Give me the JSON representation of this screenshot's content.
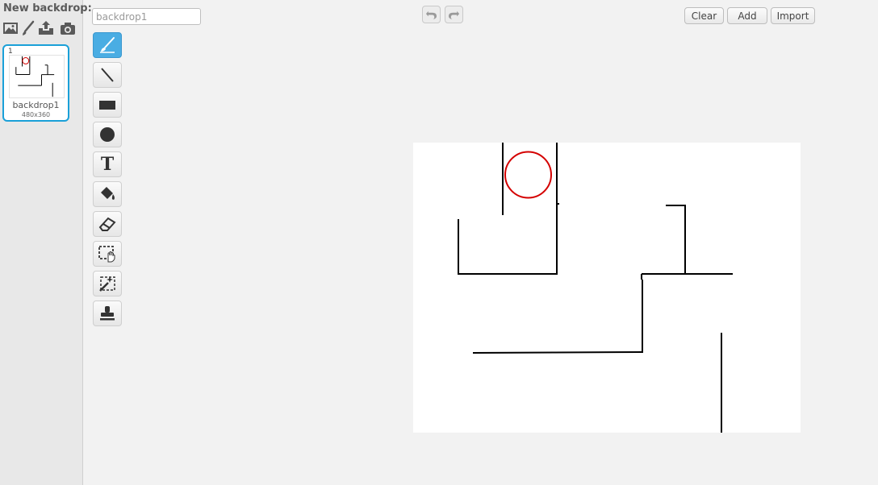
{
  "backdrop_panel": {
    "new_backdrop_label": "New backdrop:",
    "icons": [
      "choose-from-library-icon",
      "paint-new-icon",
      "upload-icon",
      "camera-icon"
    ],
    "backdrops": [
      {
        "index": "1",
        "name": "backdrop1",
        "size": "480x360"
      }
    ]
  },
  "editor": {
    "name_field_value": "backdrop1",
    "name_field_placeholder": "backdrop1",
    "undo_icon": "undo-icon",
    "redo_icon": "redo-icon",
    "clear_label": "Clear",
    "add_label": "Add",
    "import_label": "Import",
    "tools": [
      {
        "name": "brush",
        "icon": "brush-icon",
        "active": true
      },
      {
        "name": "line",
        "icon": "line-icon"
      },
      {
        "name": "rectangle",
        "icon": "rectangle-icon"
      },
      {
        "name": "ellipse",
        "icon": "ellipse-icon"
      },
      {
        "name": "text",
        "icon": "text-icon",
        "glyph": "T"
      },
      {
        "name": "fill",
        "icon": "fill-bucket-icon"
      },
      {
        "name": "eraser",
        "icon": "eraser-icon"
      },
      {
        "name": "select",
        "icon": "select-icon"
      },
      {
        "name": "remove-background",
        "icon": "magic-wand-icon"
      },
      {
        "name": "stamp",
        "icon": "stamp-icon"
      }
    ]
  },
  "colors": {
    "accent": "#1aa0d8",
    "active_tool": "#4aade3",
    "stroke": "#000000",
    "circle": "#d40000"
  }
}
